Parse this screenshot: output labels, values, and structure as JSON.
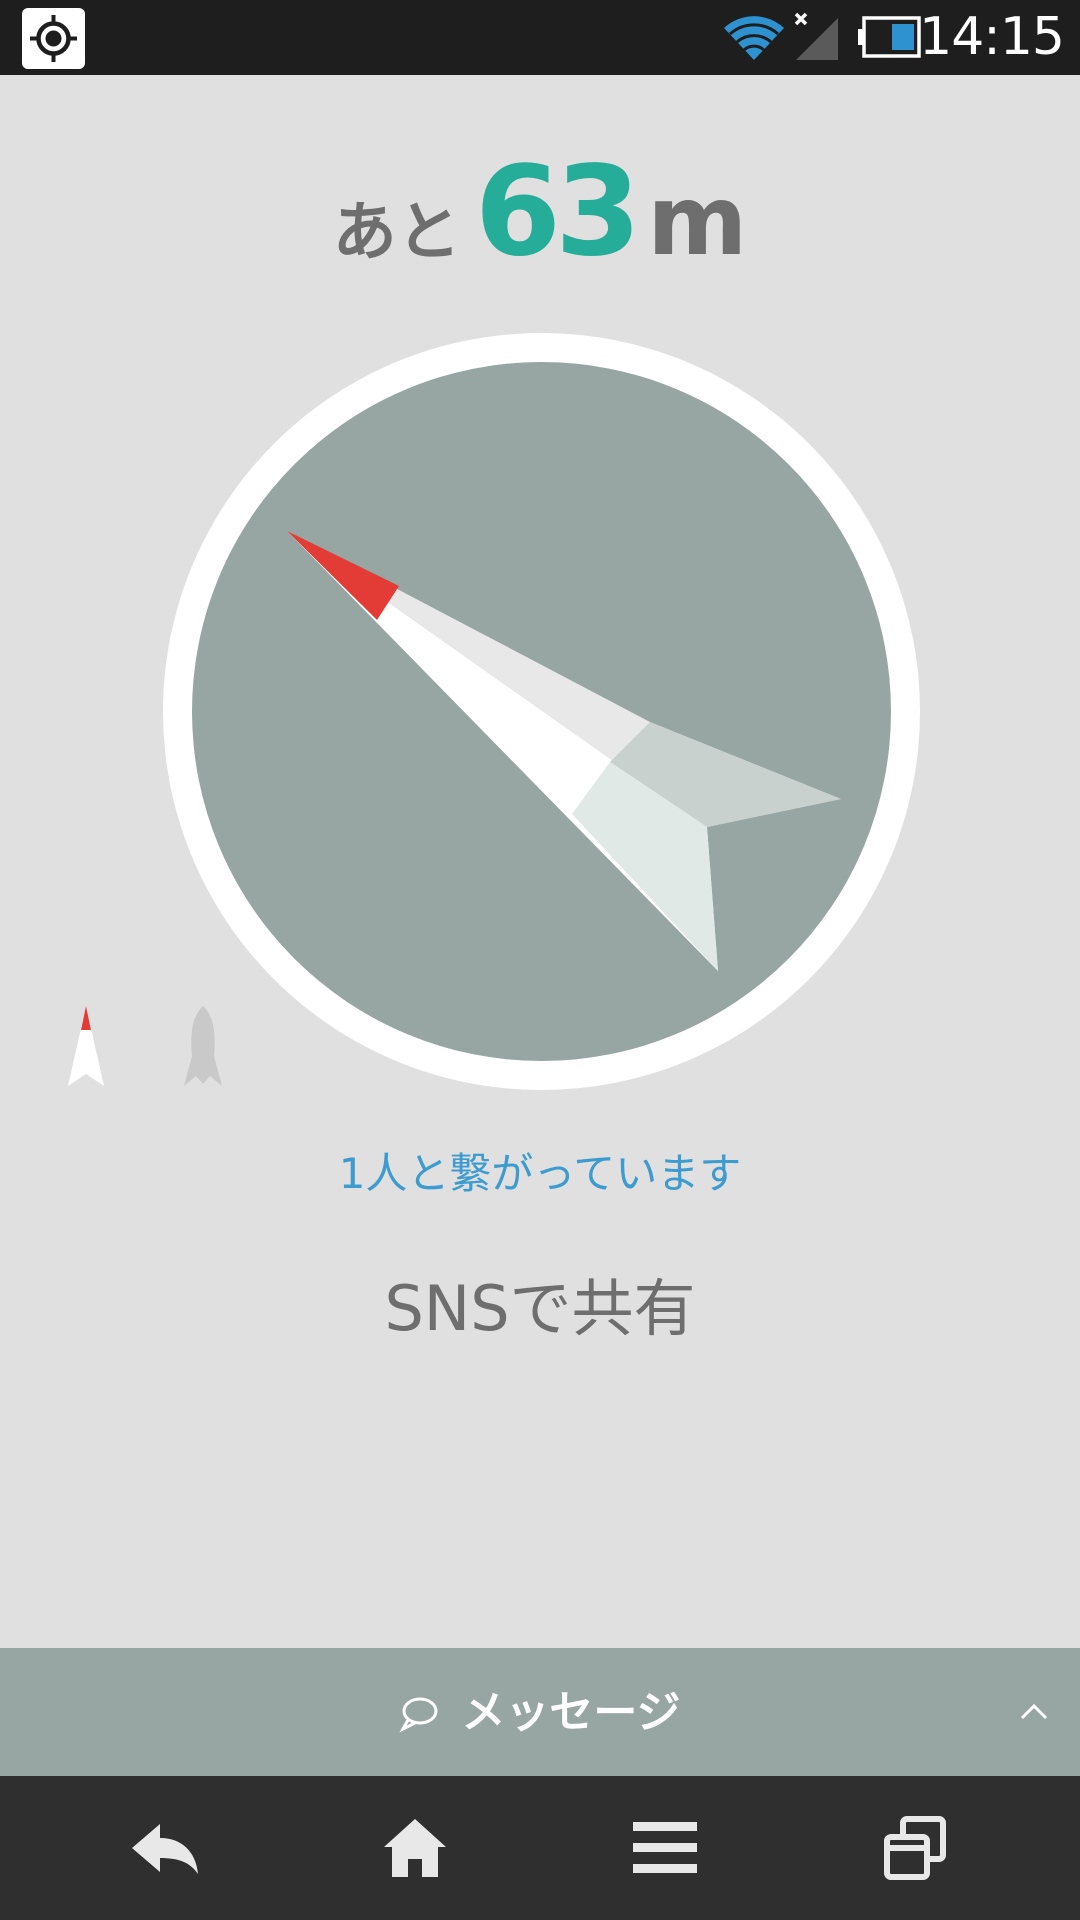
{
  "status_bar": {
    "time": "14:15",
    "icons": [
      "gps-icon",
      "wifi-icon",
      "signal-icon",
      "battery-icon"
    ]
  },
  "distance": {
    "prefix": "あと",
    "value": "63",
    "unit": "m"
  },
  "compass": {
    "modes": [
      "arrow-mode-icon",
      "rocket-mode-icon"
    ],
    "colors": {
      "ring": "#ffffff",
      "face": "#97a6a2",
      "tip": "#e33b35"
    }
  },
  "connection_status": "1人と繋がっています",
  "share_label": "SNSで共有",
  "message_bar": {
    "label": "メッセージ",
    "icon": "speech-bubble-icon",
    "expand_icon": "chevron-up-icon"
  },
  "nav_bar": {
    "icons": [
      "back-icon",
      "home-icon",
      "menu-icon",
      "recent-apps-icon"
    ]
  },
  "colors": {
    "accent": "#26ad99",
    "link": "#3d9bd0",
    "text": "#6e6e6e",
    "bar": "#97a6a2"
  }
}
